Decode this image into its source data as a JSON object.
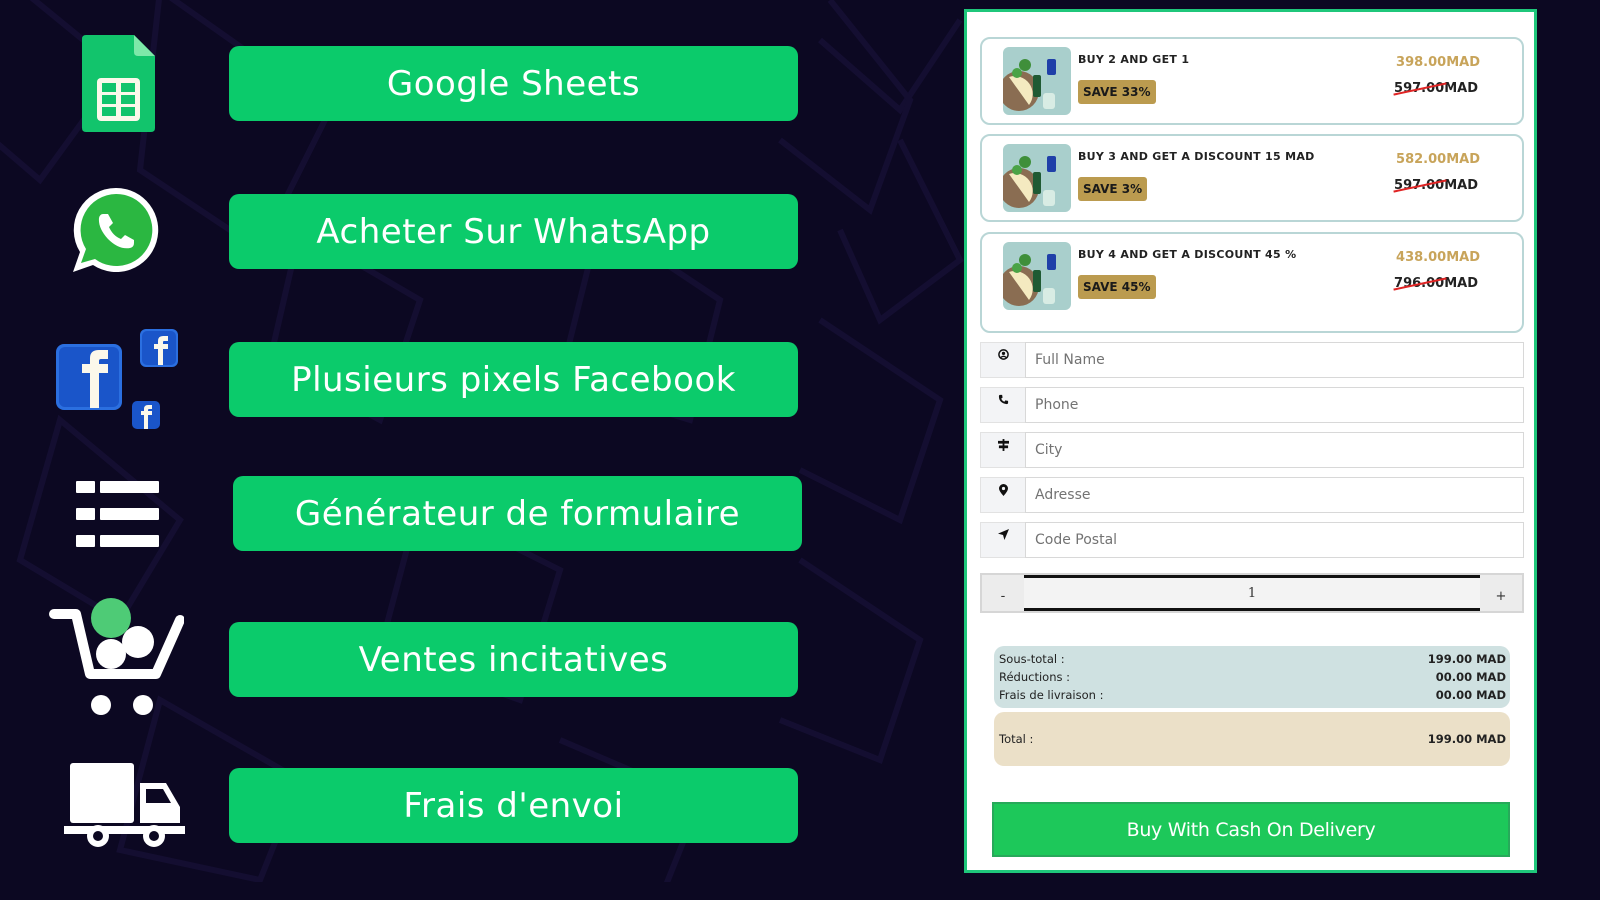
{
  "features": [
    {
      "icon": "google-sheets-icon",
      "label": "Google Sheets"
    },
    {
      "icon": "whatsapp-icon",
      "label": "Acheter Sur WhatsApp"
    },
    {
      "icon": "facebook-pixels-icon",
      "label": "Plusieurs pixels Facebook"
    },
    {
      "icon": "form-list-icon",
      "label": "Générateur de formulaire"
    },
    {
      "icon": "upsell-cart-icon",
      "label": "Ventes incitatives"
    },
    {
      "icon": "delivery-truck-icon",
      "label": "Frais d'envoi"
    }
  ],
  "form": {
    "offers": [
      {
        "title": "BUY 2 AND GET 1",
        "badge": "SAVE 33%",
        "price": "398.00MAD",
        "old_price_number": "597.00",
        "old_price_currency": "MAD"
      },
      {
        "title": "BUY 3 AND GET A DISCOUNT 15 MAD",
        "badge": "SAVE 3%",
        "price": "582.00MAD",
        "old_price_number": "597.00",
        "old_price_currency": "MAD"
      },
      {
        "title": "BUY 4 AND GET A DISCOUNT 45 %",
        "badge": "SAVE 45%",
        "price": "438.00MAD",
        "old_price_number": "796.00",
        "old_price_currency": "MAD"
      }
    ],
    "fields": [
      {
        "icon": "user-icon",
        "placeholder": "Full Name",
        "value": ""
      },
      {
        "icon": "phone-icon",
        "placeholder": "Phone",
        "value": ""
      },
      {
        "icon": "signpost-icon",
        "placeholder": "City",
        "value": ""
      },
      {
        "icon": "map-pin-icon",
        "placeholder": "Adresse",
        "value": ""
      },
      {
        "icon": "location-arrow-icon",
        "placeholder": "Code Postal",
        "value": ""
      }
    ],
    "quantity": {
      "minus": "-",
      "value": "1",
      "plus": "+"
    },
    "summary": {
      "subtotal_label": "Sous-total :",
      "subtotal_value": "199.00 MAD",
      "discount_label": "Réductions :",
      "discount_value": "00.00 MAD",
      "shipping_label": "Frais de livraison :",
      "shipping_value": "00.00 MAD",
      "total_label": "Total :",
      "total_value": "199.00 MAD"
    },
    "submit_label": "Buy With Cash On Delivery"
  },
  "colors": {
    "background": "#0c0822",
    "accent_green": "#0bcb6b",
    "cta_green": "#1dc85a",
    "gold": "#bb9b4f",
    "facebook_blue": "#1a55c9"
  }
}
